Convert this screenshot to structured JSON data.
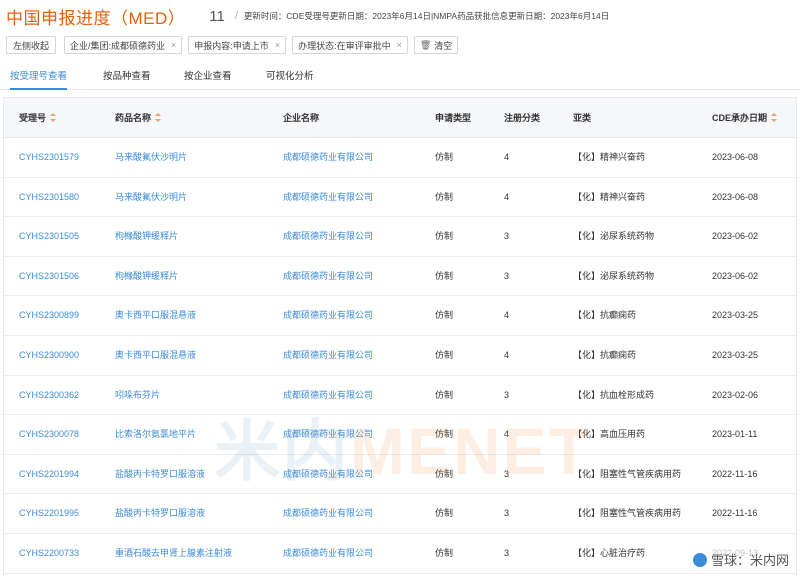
{
  "header": {
    "title": "中国申报进度（MED）",
    "count": "11",
    "separator": "/",
    "update_text": "更新时间：CDE受理号更新日期：2023年6月14日|NMPA药品获批信息更新日期：2023年6月14日"
  },
  "filters": {
    "collapse_label": "左侧收起",
    "chips": [
      {
        "label": "企业/集团:成都硕德药业",
        "close": "×"
      },
      {
        "label": "申报内容:申请上市",
        "close": "×"
      },
      {
        "label": "办理状态:在审评审批中",
        "close": "×"
      }
    ],
    "clear_label": "清空",
    "clear_icon": "trash-icon"
  },
  "tabs": [
    "按受理号查看",
    "按品种查看",
    "按企业查看",
    "可视化分析"
  ],
  "active_tab": 0,
  "table": {
    "columns": [
      "受理号",
      "药品名称",
      "企业名称",
      "申请类型",
      "注册分类",
      "亚类",
      "CDE承办日期"
    ],
    "sortable": [
      true,
      true,
      false,
      false,
      false,
      false,
      true
    ],
    "rows": [
      [
        "CYHS2301579",
        "马来酸氟伏沙明片",
        "成都硕德药业有限公司",
        "仿制",
        "4",
        "【化】精神兴奋药",
        "2023-06-08"
      ],
      [
        "CYHS2301580",
        "马来酸氟伏沙明片",
        "成都硕德药业有限公司",
        "仿制",
        "4",
        "【化】精神兴奋药",
        "2023-06-08"
      ],
      [
        "CYHS2301505",
        "枸橼酸钾缓释片",
        "成都硕德药业有限公司",
        "仿制",
        "3",
        "【化】泌尿系统药物",
        "2023-06-02"
      ],
      [
        "CYHS2301506",
        "枸橼酸钾缓释片",
        "成都硕德药业有限公司",
        "仿制",
        "3",
        "【化】泌尿系统药物",
        "2023-06-02"
      ],
      [
        "CYHS2300899",
        "奥卡西平口服混悬液",
        "成都硕德药业有限公司",
        "仿制",
        "4",
        "【化】抗癫痫药",
        "2023-03-25"
      ],
      [
        "CYHS2300900",
        "奥卡西平口服混悬液",
        "成都硕德药业有限公司",
        "仿制",
        "4",
        "【化】抗癫痫药",
        "2023-03-25"
      ],
      [
        "CYHS2300362",
        "吲哚布芬片",
        "成都硕德药业有限公司",
        "仿制",
        "3",
        "【化】抗血栓形成药",
        "2023-02-06"
      ],
      [
        "CYHS2300078",
        "比索洛尔氨氯地平片",
        "成都硕德药业有限公司",
        "仿制",
        "4",
        "【化】高血压用药",
        "2023-01-11"
      ],
      [
        "CYHS2201994",
        "盐酸丙卡特罗口服溶液",
        "成都硕德药业有限公司",
        "仿制",
        "3",
        "【化】阻塞性气管疾病用药",
        "2022-11-16"
      ],
      [
        "CYHS2201995",
        "盐酸丙卡特罗口服溶液",
        "成都硕德药业有限公司",
        "仿制",
        "3",
        "【化】阻塞性气管疾病用药",
        "2022-11-16"
      ],
      [
        "CYHS2200733",
        "重酒石酸去甲肾上腺素注射液",
        "成都硕德药业有限公司",
        "仿制",
        "3",
        "【化】心脏治疗药",
        "2022-09-13"
      ]
    ]
  },
  "watermark": {
    "part1": "米内",
    "part2": "MENET"
  },
  "badge": {
    "text": "雪球：米内网"
  },
  "colors": {
    "accent": "#3c8bd8",
    "title": "#e2620e",
    "sort": "#e9a46a"
  }
}
